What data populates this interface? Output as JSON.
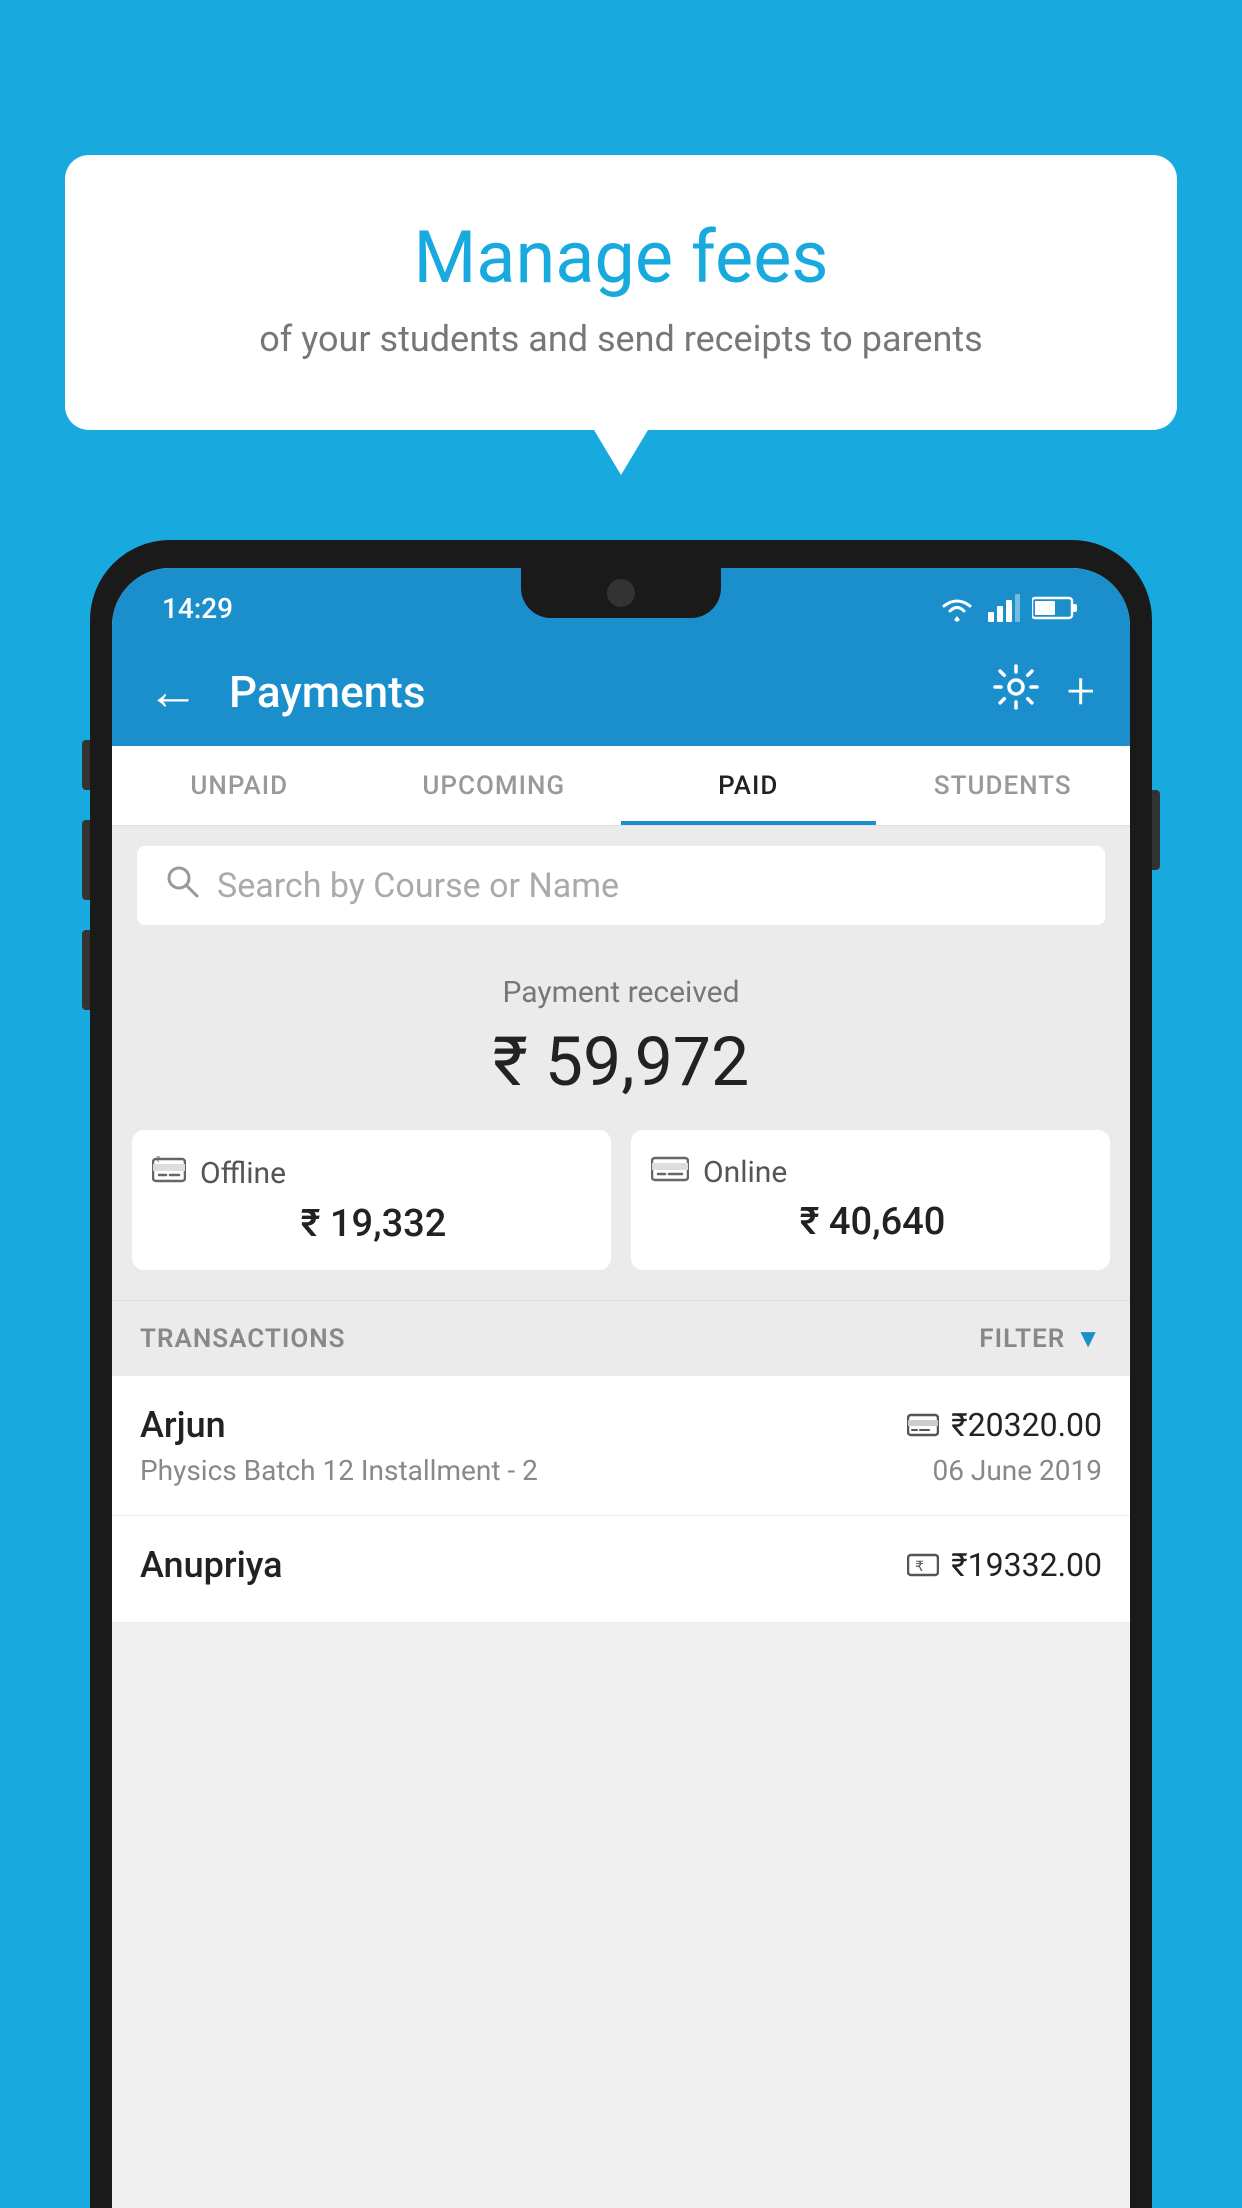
{
  "page": {
    "background_color": "#18AADF"
  },
  "tooltip": {
    "title": "Manage fees",
    "subtitle": "of your students and send receipts to parents"
  },
  "status_bar": {
    "time": "14:29"
  },
  "app_bar": {
    "back_label": "←",
    "title": "Payments",
    "gear_icon": "⚙",
    "plus_icon": "+"
  },
  "tabs": [
    {
      "label": "UNPAID",
      "active": false
    },
    {
      "label": "UPCOMING",
      "active": false
    },
    {
      "label": "PAID",
      "active": true
    },
    {
      "label": "STUDENTS",
      "active": false
    }
  ],
  "search": {
    "placeholder": "Search by Course or Name"
  },
  "payment_summary": {
    "label": "Payment received",
    "amount": "₹ 59,972",
    "offline": {
      "icon": "🪙",
      "label": "Offline",
      "amount": "₹ 19,332"
    },
    "online": {
      "icon": "💳",
      "label": "Online",
      "amount": "₹ 40,640"
    }
  },
  "transactions": {
    "header": "TRANSACTIONS",
    "filter_label": "FILTER",
    "items": [
      {
        "name": "Arjun",
        "amount": "₹20320.00",
        "course": "Physics Batch 12 Installment - 2",
        "date": "06 June 2019",
        "payment_type": "online"
      },
      {
        "name": "Anupriya",
        "amount": "₹19332.00",
        "course": "",
        "date": "",
        "payment_type": "offline"
      }
    ]
  }
}
